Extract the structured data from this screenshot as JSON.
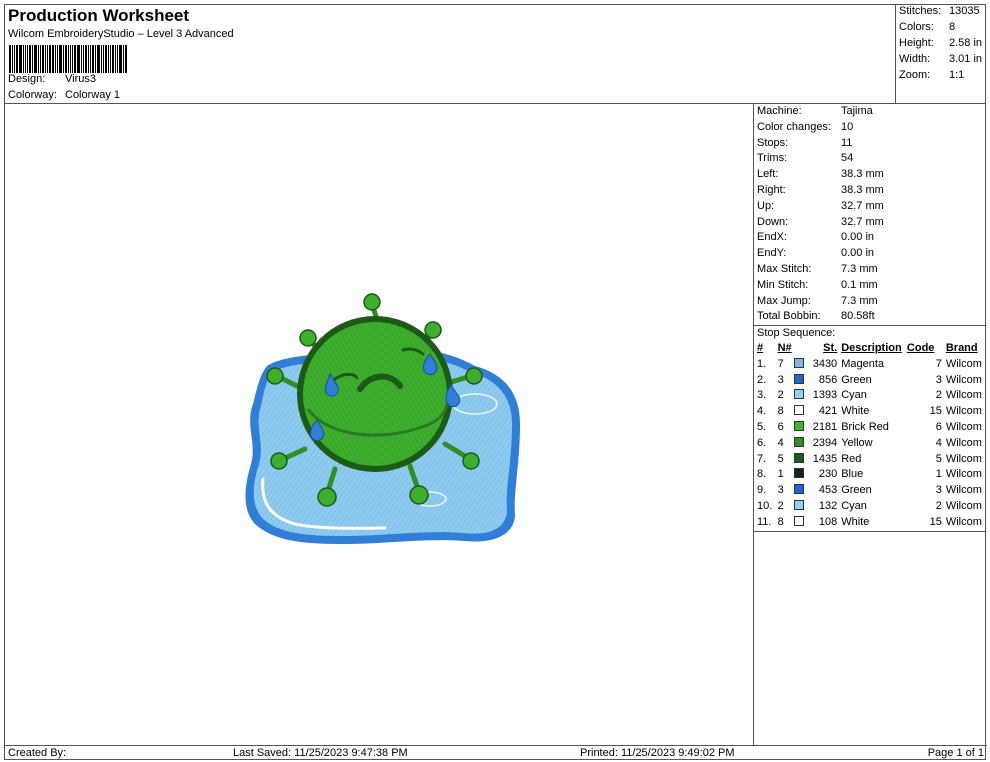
{
  "header": {
    "title": "Production Worksheet",
    "subtitle": "Wilcom EmbroideryStudio – Level 3 Advanced",
    "design_label": "Design:",
    "design_value": "Virus3",
    "colorway_label": "Colorway:",
    "colorway_value": "Colorway 1"
  },
  "stats": [
    {
      "label": "Stitches:",
      "value": "13035"
    },
    {
      "label": "Colors:",
      "value": "8"
    },
    {
      "label": "Height:",
      "value": "2.58 in"
    },
    {
      "label": "Width:",
      "value": "3.01 in"
    },
    {
      "label": "Zoom:",
      "value": "1:1"
    }
  ],
  "machine": [
    {
      "label": "Machine:",
      "value": "Tajima"
    },
    {
      "label": "Color changes:",
      "value": "10"
    },
    {
      "label": "Stops:",
      "value": "11"
    },
    {
      "label": "Trims:",
      "value": "54"
    },
    {
      "label": "Left:",
      "value": "38.3 mm"
    },
    {
      "label": "Right:",
      "value": "38.3 mm"
    },
    {
      "label": "Up:",
      "value": "32.7 mm"
    },
    {
      "label": "Down:",
      "value": "32.7 mm"
    },
    {
      "label": "EndX:",
      "value": "0.00 in"
    },
    {
      "label": "EndY:",
      "value": "0.00 in"
    },
    {
      "label": "Max Stitch:",
      "value": "7.3 mm"
    },
    {
      "label": "Min Stitch:",
      "value": "0.1 mm"
    },
    {
      "label": "Max Jump:",
      "value": "7.3 mm"
    },
    {
      "label": "Total Bobbin:",
      "value": "80.58ft"
    }
  ],
  "stop_sequence": {
    "title": "Stop Sequence:",
    "headers": {
      "idx": "#",
      "n": "N#",
      "st": "St.",
      "desc": "Description",
      "code": "Code",
      "brand": "Brand"
    },
    "rows": [
      {
        "idx": "1.",
        "n": "7",
        "color": "#7fb8e6",
        "st": "3430",
        "desc": "Magenta",
        "code": "7",
        "brand": "Wilcom"
      },
      {
        "idx": "2.",
        "n": "3",
        "color": "#1f66d1",
        "st": "856",
        "desc": "Green",
        "code": "3",
        "brand": "Wilcom"
      },
      {
        "idx": "3.",
        "n": "2",
        "color": "#8fd3f5",
        "st": "1393",
        "desc": "Cyan",
        "code": "2",
        "brand": "Wilcom"
      },
      {
        "idx": "4.",
        "n": "8",
        "color": "#ffffff",
        "st": "421",
        "desc": "White",
        "code": "15",
        "brand": "Wilcom"
      },
      {
        "idx": "5.",
        "n": "6",
        "color": "#3cb52a",
        "st": "2181",
        "desc": "Brick Red",
        "code": "6",
        "brand": "Wilcom"
      },
      {
        "idx": "6.",
        "n": "4",
        "color": "#2e8f22",
        "st": "2394",
        "desc": "Yellow",
        "code": "4",
        "brand": "Wilcom"
      },
      {
        "idx": "7.",
        "n": "5",
        "color": "#1d5a16",
        "st": "1435",
        "desc": "Red",
        "code": "5",
        "brand": "Wilcom"
      },
      {
        "idx": "8.",
        "n": "1",
        "color": "#102810",
        "st": "230",
        "desc": "Blue",
        "code": "1",
        "brand": "Wilcom"
      },
      {
        "idx": "9.",
        "n": "3",
        "color": "#1f66d1",
        "st": "453",
        "desc": "Green",
        "code": "3",
        "brand": "Wilcom"
      },
      {
        "idx": "10.",
        "n": "2",
        "color": "#8fd3f5",
        "st": "132",
        "desc": "Cyan",
        "code": "2",
        "brand": "Wilcom"
      },
      {
        "idx": "11.",
        "n": "8",
        "color": "#ffffff",
        "st": "108",
        "desc": "White",
        "code": "15",
        "brand": "Wilcom"
      }
    ]
  },
  "footer": {
    "created": "Created By:",
    "saved": "Last Saved: 11/25/2023 9:47:38 PM",
    "printed": "Printed: 11/25/2023 9:49:02 PM",
    "page": "Page 1 of 1"
  }
}
